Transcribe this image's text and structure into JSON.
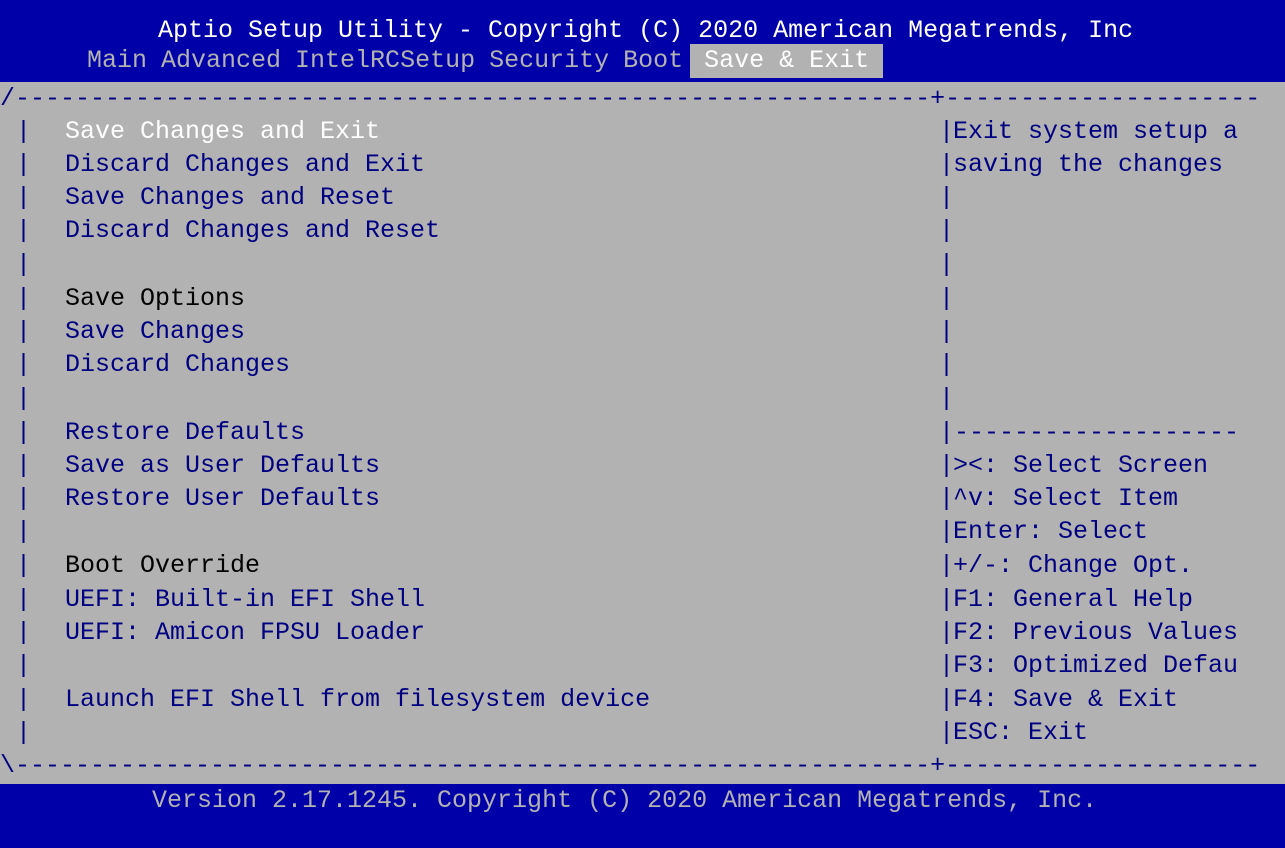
{
  "header": {
    "title": "Aptio Setup Utility - Copyright (C) 2020 American Megatrends, Inc",
    "tabs": [
      {
        "label": "Main"
      },
      {
        "label": "Advanced"
      },
      {
        "label": "IntelRCSetup"
      },
      {
        "label": "Security"
      },
      {
        "label": "Boot"
      },
      {
        "label": "Save & Exit"
      }
    ],
    "active_tab": "Save & Exit"
  },
  "menu": {
    "items": [
      {
        "label": "Save Changes and Exit"
      },
      {
        "label": "Discard Changes and Exit"
      },
      {
        "label": "Save Changes and Reset"
      },
      {
        "label": "Discard Changes and Reset"
      },
      {
        "label": "Save Options"
      },
      {
        "label": "Save Changes"
      },
      {
        "label": "Discard Changes"
      },
      {
        "label": "Restore Defaults"
      },
      {
        "label": "Save as User Defaults"
      },
      {
        "label": "Restore User Defaults"
      },
      {
        "label": "Boot Override"
      },
      {
        "label": "UEFI: Built-in EFI Shell"
      },
      {
        "label": "UEFI: Amicon FPSU Loader"
      },
      {
        "label": "Launch EFI Shell from filesystem device"
      }
    ]
  },
  "help": {
    "description": [
      "Exit system setup a",
      "saving the changes"
    ],
    "keys": [
      "><: Select Screen",
      "^v: Select Item",
      "Enter: Select",
      "+/-: Change Opt.",
      "F1: General Help",
      "F2: Previous Values",
      "F3: Optimized Defau",
      "F4: Save & Exit",
      "ESC: Exit"
    ]
  },
  "footer": {
    "version": "Version 2.17.1245. Copyright (C) 2020 American Megatrends, Inc."
  },
  "colors": {
    "background": "#b2b2b2",
    "title_bar": "#0000a8",
    "text": "#000080",
    "highlight": "#ffffff"
  }
}
